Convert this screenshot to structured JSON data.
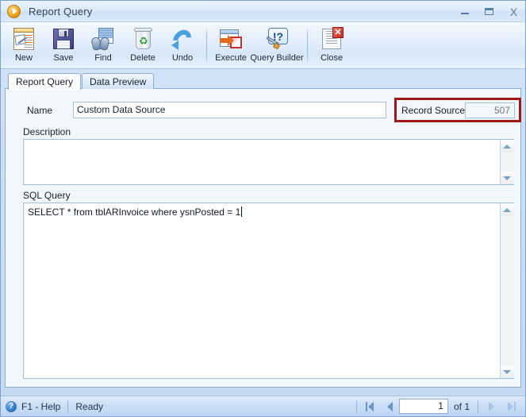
{
  "window": {
    "title": "Report Query",
    "app_icon": "play-circle-icon",
    "minimize_label": "–",
    "maximize_label": "□",
    "close_label": "X"
  },
  "toolbar": {
    "buttons": [
      {
        "label": "New",
        "icon": "new-document-icon"
      },
      {
        "label": "Save",
        "icon": "floppy-disk-icon"
      },
      {
        "label": "Find",
        "icon": "binoculars-icon"
      },
      {
        "label": "Delete",
        "icon": "recycle-bin-icon"
      },
      {
        "label": "Undo",
        "icon": "undo-arrow-icon"
      },
      {
        "label": "Execute",
        "icon": "execute-window-icon"
      },
      {
        "label": "Query Builder",
        "icon": "question-bubble-wrench-icon"
      },
      {
        "label": "Close",
        "icon": "document-red-x-icon"
      }
    ]
  },
  "tabs": [
    {
      "label": "Report Query",
      "active": true
    },
    {
      "label": "Data Preview",
      "active": false
    }
  ],
  "form": {
    "name_label": "Name",
    "name_value": "Custom Data Source",
    "record_source_id_label": "Record Source ID",
    "record_source_id_value": "507",
    "record_source_highlight_color": "#a01717",
    "description_label": "Description",
    "description_value": "",
    "sql_query_label": "SQL Query",
    "sql_query_value": "SELECT * from tblARInvoice where ysnPosted = 1"
  },
  "statusbar": {
    "help_icon": "question-mark-circle-icon",
    "help_label": "F1 - Help",
    "status_label": "Ready",
    "nav": {
      "first_icon": "first-record-icon",
      "prev_icon": "previous-record-icon",
      "page_value": "1",
      "of_label": "of 1",
      "next_icon": "next-record-icon",
      "last_icon": "last-record-icon"
    }
  }
}
